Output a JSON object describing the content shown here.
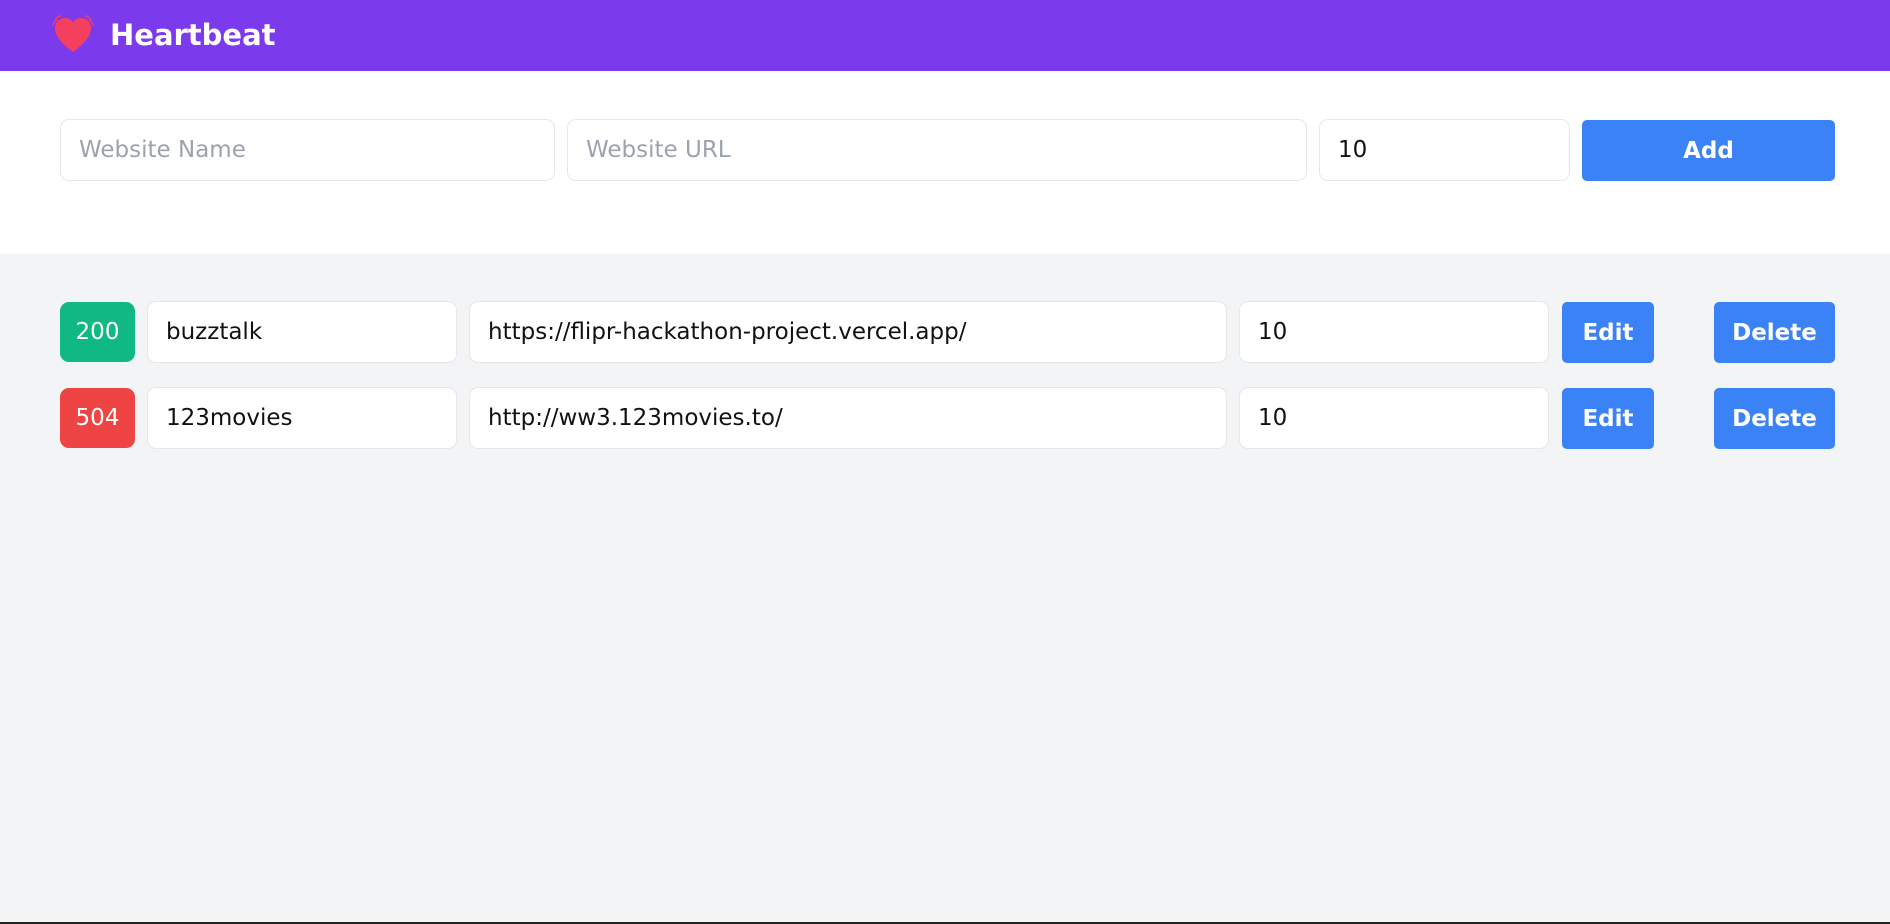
{
  "app": {
    "title": "Heartbeat",
    "logo_icon": "heart-icon",
    "colors": {
      "navbar": "#7c3aed",
      "heart": "#f43f5e",
      "button": "#3b82f6",
      "status_ok": "#10b981",
      "status_error": "#ef4444"
    }
  },
  "add_form": {
    "name_placeholder": "Website Name",
    "name_value": "",
    "url_placeholder": "Website URL",
    "url_value": "",
    "interval_value": "10",
    "add_label": "Add"
  },
  "sites": [
    {
      "status": "200",
      "status_color": "#10b981",
      "name": "buzztalk",
      "url": "https://flipr-hackathon-project.vercel.app/",
      "interval": "10",
      "edit_label": "Edit",
      "delete_label": "Delete"
    },
    {
      "status": "504",
      "status_color": "#ef4444",
      "name": "123movies",
      "url": "http://ww3.123movies.to/",
      "interval": "10",
      "edit_label": "Edit",
      "delete_label": "Delete"
    }
  ]
}
